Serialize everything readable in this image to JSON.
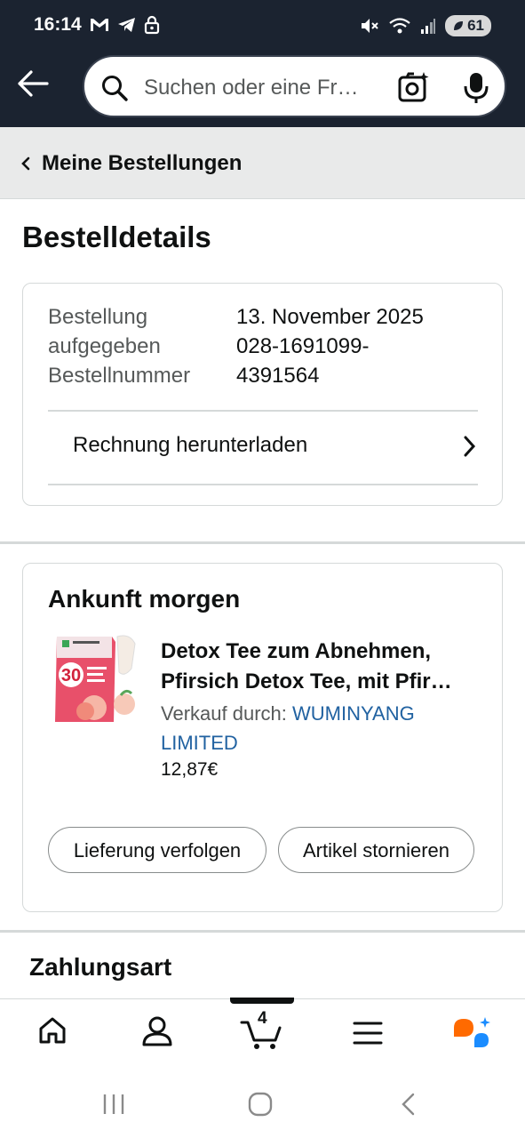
{
  "status_bar": {
    "time": "16:14",
    "battery": "61"
  },
  "search": {
    "placeholder": "Suchen oder eine Fr…"
  },
  "breadcrumb": {
    "label": "Meine Bestellungen"
  },
  "page_title": "Bestelldetails",
  "order_summary": {
    "date_label_line1": "Bestellung",
    "date_label_line2": "aufgegeben",
    "number_label": "Bestellnummer",
    "date_value": "13. November 2025",
    "number_value_line1": "028-1691099-",
    "number_value_line2": "4391564",
    "invoice_link": "Rechnung herunterladen"
  },
  "shipment": {
    "heading": "Ankunft morgen",
    "product_title_line1": "Detox Tee zum Abnehmen,",
    "product_title_line2": "Pfirsich Detox Tee, mit Pfir…",
    "seller_prefix": "Verkauf durch:",
    "seller_name_line1": "WUMINYANG",
    "seller_name_line2": "LIMITED",
    "price": "12,87€",
    "track_button": "Lieferung verfolgen",
    "cancel_button": "Artikel stornieren",
    "thumbnail_badge": "30"
  },
  "payment_section": {
    "heading": "Zahlungsart"
  },
  "bottom_nav": {
    "cart_count": "4",
    "items": [
      "home-icon",
      "account-icon",
      "cart-icon",
      "menu-icon",
      "rufus-ai-icon"
    ]
  },
  "colors": {
    "header_bg": "#1b2330",
    "link": "#2162a1",
    "ai_orange": "#ff6a00",
    "ai_blue": "#1a8cff"
  }
}
